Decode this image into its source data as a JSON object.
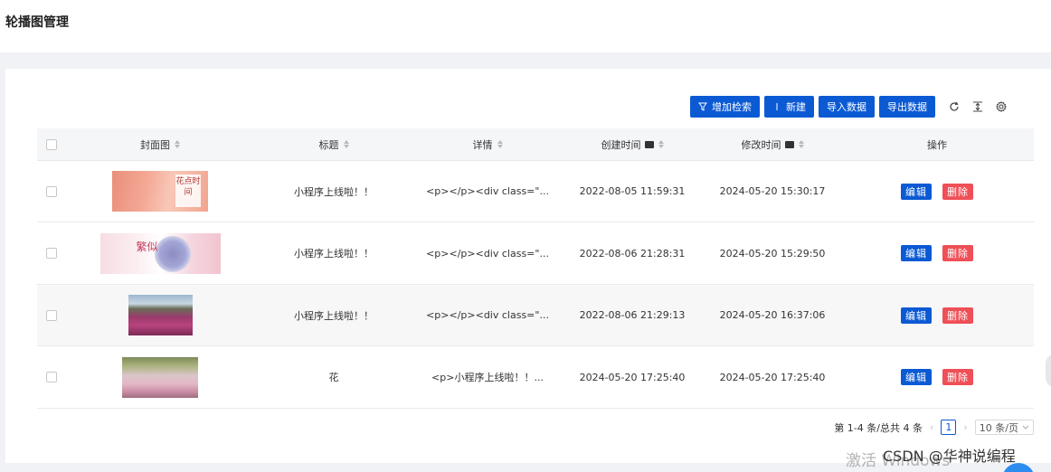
{
  "page": {
    "title": "轮播图管理"
  },
  "toolbar": {
    "filter_label": "增加检索",
    "new_label": "新建",
    "import_label": "导入数据",
    "export_label": "导出数据",
    "icons": [
      "refresh-icon",
      "column-height-icon",
      "settings-icon"
    ]
  },
  "table": {
    "headers": {
      "cover": "封面图",
      "title": "标题",
      "detail": "详情",
      "created": "创建时间",
      "modified": "修改时间",
      "ops": "操作"
    },
    "edit_label": "编辑",
    "delete_label": "删除",
    "rows": [
      {
        "title": "小程序上线啦！！",
        "detail": "<p></p><div class=\"...",
        "created": "2022-08-05 11:59:31",
        "modified": "2024-05-20 15:30:17",
        "cover_text": "花点时间"
      },
      {
        "title": "小程序上线啦！！",
        "detail": "<p></p><div class=\"...",
        "created": "2022-08-06 21:28:31",
        "modified": "2024-05-20 15:29:50",
        "cover_text": "繁似"
      },
      {
        "title": "小程序上线啦！！",
        "detail": "<p></p><div class=\"...",
        "created": "2022-08-06 21:29:13",
        "modified": "2024-05-20 16:37:06"
      },
      {
        "title": "花",
        "detail": "<p>小程序上线啦！！...",
        "created": "2024-05-20 17:25:40",
        "modified": "2024-05-20 17:25:40"
      }
    ]
  },
  "pagination": {
    "summary": "第 1-4 条/总共 4 条",
    "current_page": "1",
    "page_size": "10 条/页"
  },
  "overlay": {
    "watermark": "激活 Windows",
    "csdn": "CSDN @华神说编程"
  }
}
